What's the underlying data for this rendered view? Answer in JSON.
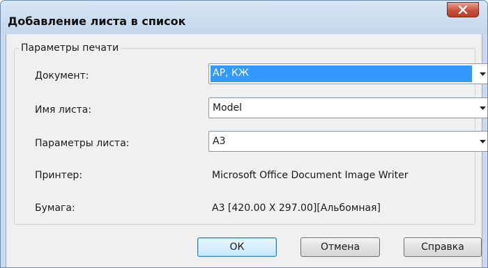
{
  "dialog": {
    "title": "Добавление листа в список",
    "group_title": "Параметры печати"
  },
  "fields": {
    "document": {
      "label": "Документ:",
      "value": "АР, КЖ"
    },
    "sheet_name": {
      "label": "Имя листа:",
      "value": "Model"
    },
    "sheet_params": {
      "label": "Параметры листа:",
      "value": "А3"
    },
    "printer": {
      "label": "Принтер:",
      "value": "Microsoft Office Document Image Writer"
    },
    "paper": {
      "label": "Бумага:",
      "value": "А3 [420.00 X 297.00][Альбомная]"
    }
  },
  "buttons": {
    "ok": "ОК",
    "cancel": "Отмена",
    "help": "Справка"
  },
  "icons": {
    "close": "close-x-icon",
    "dropdown": "chevron-down-icon"
  },
  "colors": {
    "selection": "#3399ff",
    "close_button": "#c8503a",
    "frame": "#c9dcef"
  }
}
